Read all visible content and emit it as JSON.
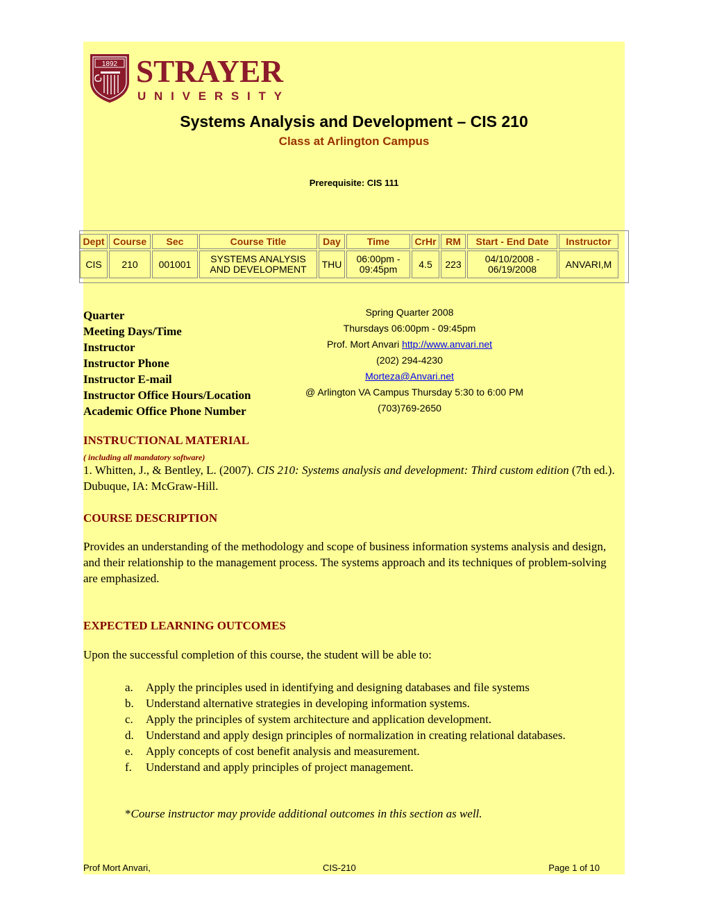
{
  "logo": {
    "year": "1892",
    "name_main": "STRAYER",
    "name_sub": "UNIVERSITY",
    "brand_color": "#8b1a2b"
  },
  "header": {
    "title": "Systems Analysis and Development – CIS 210",
    "subtitle": "Class at Arlington Campus",
    "prerequisite": "Prerequisite: CIS 111"
  },
  "schedule": {
    "headers": [
      "Dept",
      "Course",
      "Sec",
      "Course Title",
      "Day",
      "Time",
      "CrHr",
      "RM",
      "Start - End Date",
      "Instructor"
    ],
    "row": {
      "dept": "CIS",
      "course": "210",
      "sec": "001001",
      "title_line1": "SYSTEMS ANALYSIS",
      "title_line2": "AND DEVELOPMENT",
      "day": "THU",
      "time_line1": "06:00pm -",
      "time_line2": "09:45pm",
      "crhr": "4.5",
      "rm": "223",
      "date_line1": "04/10/2008 -",
      "date_line2": "06/19/2008",
      "instructor": "ANVARI,M"
    }
  },
  "info": {
    "quarter_label": "Quarter",
    "quarter_value": "Spring Quarter 2008",
    "meeting_label": "Meeting Days/Time",
    "meeting_value": "Thursdays 06:00pm - 09:45pm",
    "instructor_label": "Instructor",
    "instructor_value": "Prof. Mort Anvari",
    "instructor_link": "http://www.anvari.net",
    "phone_label": "Instructor Phone",
    "phone_value": "(202) 294-4230",
    "email_label": "Instructor E-mail",
    "email_value": "Morteza@Anvari.net",
    "office_label": "Instructor Office Hours/Location",
    "office_value": "@ Arlington VA Campus Thursday 5:30 to 6:00 PM",
    "academic_label": "Academic Office Phone Number",
    "academic_value": "(703)769-2650"
  },
  "material": {
    "heading": "INSTRUCTIONAL MATERIAL",
    "note": "( including all mandatory software)",
    "ref_prefix": "1. Whitten, J., & Bentley, L. (2007). ",
    "ref_title_a": "CIS 210: Systems analysis and development: Third custom",
    "ref_title_b": "edition",
    "ref_suffix": " (7th ed.). Dubuque, IA: McGraw-Hill."
  },
  "description": {
    "heading": "COURSE DESCRIPTION",
    "text": "Provides an understanding of the methodology and scope of business information systems analysis and design, and their relationship to the management process.  The systems approach and its techniques of problem-solving are emphasized."
  },
  "outcomes": {
    "heading": "EXPECTED LEARNING OUTCOMES",
    "intro": "Upon the successful completion of this course, the student will be able to:",
    "items": [
      {
        "marker": "a.",
        "text": "Apply the principles used in identifying and designing databases and file systems"
      },
      {
        "marker": "b.",
        "text": "Understand alternative strategies in developing information systems."
      },
      {
        "marker": "c.",
        "text": "Apply the principles of system architecture and application development."
      },
      {
        "marker": "d.",
        "text": "Understand and apply design principles of normalization in creating relational databases."
      },
      {
        "marker": "e.",
        "text": "Apply concepts of cost benefit analysis and measurement."
      },
      {
        "marker": "f.",
        "text": "Understand and apply principles of project management."
      }
    ],
    "note_star": "*",
    "note_text": "Course instructor may provide additional outcomes in this section as well."
  },
  "footer": {
    "left": "Prof Mort Anvari,",
    "center": "CIS-210",
    "right": "Page 1 of 10"
  }
}
